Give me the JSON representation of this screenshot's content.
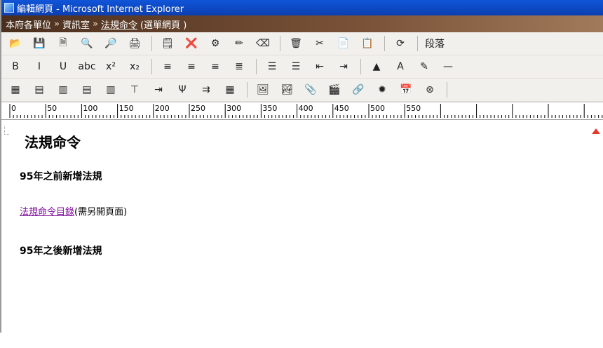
{
  "window": {
    "title": "編輯網頁 - Microsoft Internet Explorer"
  },
  "breadcrumb": {
    "home": "本府各單位",
    "section": "資訊室",
    "current": "法規命令",
    "suffix": "(選單網頁 )",
    "separator": "»"
  },
  "toolbar1": {
    "items": [
      {
        "name": "open-folder-icon",
        "glyph": "📂"
      },
      {
        "name": "save-icon",
        "glyph": "💾"
      },
      {
        "name": "copy-page-icon",
        "glyph": "🗎"
      },
      {
        "name": "preview-icon",
        "glyph": "🔍"
      },
      {
        "name": "spellcheck-icon",
        "glyph": "🔎"
      },
      {
        "name": "print-icon",
        "glyph": "🖨"
      },
      {
        "sep": true
      },
      {
        "name": "template-icon",
        "glyph": "🗒"
      },
      {
        "name": "delete-page-icon",
        "glyph": "❌"
      },
      {
        "name": "stamp-icon",
        "glyph": "⚙"
      },
      {
        "name": "format-painter-icon",
        "glyph": "✏"
      },
      {
        "name": "eraser-icon",
        "glyph": "⌫"
      },
      {
        "sep": true
      },
      {
        "name": "trash-icon",
        "glyph": "🗑"
      },
      {
        "name": "cut-icon",
        "glyph": "✂"
      },
      {
        "name": "copy-icon",
        "glyph": "📄"
      },
      {
        "name": "paste-icon",
        "glyph": "📋"
      },
      {
        "sep": true
      },
      {
        "name": "refresh-icon",
        "glyph": "⟳"
      },
      {
        "sep": true
      }
    ],
    "paragraph_label": "段落"
  },
  "toolbar2": {
    "items": [
      {
        "name": "bold-icon",
        "glyph": "B"
      },
      {
        "name": "italic-icon",
        "glyph": "I"
      },
      {
        "name": "underline-icon",
        "glyph": "U"
      },
      {
        "name": "strikethrough-icon",
        "glyph": "abc"
      },
      {
        "name": "superscript-icon",
        "glyph": "x²"
      },
      {
        "name": "subscript-icon",
        "glyph": "x₂"
      },
      {
        "sep": true
      },
      {
        "name": "align-left-icon",
        "glyph": "≡"
      },
      {
        "name": "align-center-icon",
        "glyph": "≡"
      },
      {
        "name": "align-right-icon",
        "glyph": "≡"
      },
      {
        "name": "justify-icon",
        "glyph": "≣"
      },
      {
        "sep": true
      },
      {
        "name": "numbered-list-icon",
        "glyph": "☰"
      },
      {
        "name": "bullet-list-icon",
        "glyph": "☰"
      },
      {
        "name": "outdent-icon",
        "glyph": "⇤"
      },
      {
        "name": "indent-icon",
        "glyph": "⇥"
      },
      {
        "sep": true
      },
      {
        "name": "fill-color-icon",
        "glyph": "▲"
      },
      {
        "name": "font-color-icon",
        "glyph": "A"
      },
      {
        "name": "highlight-icon",
        "glyph": "✎"
      },
      {
        "name": "horizontal-rule-icon",
        "glyph": "—"
      }
    ]
  },
  "toolbar3": {
    "items": [
      {
        "name": "insert-table-icon",
        "glyph": "▦"
      },
      {
        "name": "insert-row-icon",
        "glyph": "▤"
      },
      {
        "name": "insert-column-icon",
        "glyph": "▥"
      },
      {
        "name": "delete-row-icon",
        "glyph": "▤"
      },
      {
        "name": "delete-column-icon",
        "glyph": "▥"
      },
      {
        "name": "split-cell-icon",
        "glyph": "⊤"
      },
      {
        "name": "merge-right-icon",
        "glyph": "⇥"
      },
      {
        "name": "merge-down-icon",
        "glyph": "Ψ"
      },
      {
        "name": "split-columns-icon",
        "glyph": "⇉"
      },
      {
        "name": "table-properties-icon",
        "glyph": "▦"
      },
      {
        "sep": true
      },
      {
        "name": "insert-image-icon",
        "glyph": "🖼"
      },
      {
        "name": "insert-picture-icon",
        "glyph": "🏞"
      },
      {
        "name": "attach-icon",
        "glyph": "📎"
      },
      {
        "name": "media-icon",
        "glyph": "🎬"
      },
      {
        "name": "link-icon",
        "glyph": "🔗"
      },
      {
        "name": "flash-icon",
        "glyph": "✹"
      },
      {
        "name": "form-icon",
        "glyph": "📅"
      },
      {
        "name": "special-char-icon",
        "glyph": "⊛"
      },
      {
        "sep": true
      }
    ]
  },
  "ruler": {
    "labels": [
      "0",
      "50",
      "100",
      "150",
      "200",
      "250",
      "300",
      "350",
      "400",
      "450",
      "500",
      "550"
    ]
  },
  "content": {
    "heading": "法規命令",
    "subheading1": "95年之前新增法規",
    "link_text": "法規命令目錄",
    "link_note": "(需另開頁面)",
    "subheading2": "95年之後新增法規"
  },
  "colors": {
    "titlebar": "#0b3fb0",
    "crumbbar": "#6b4a33",
    "link": "#7f0d9a"
  }
}
